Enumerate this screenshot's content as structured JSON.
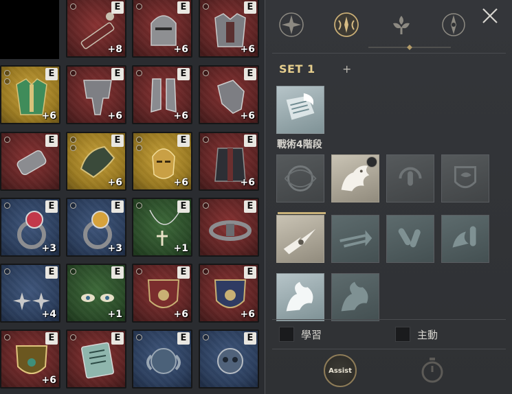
{
  "inventory": {
    "rows": [
      [
        null,
        {
          "icon": "blaster-cannon-icon",
          "badge": "E",
          "level": "+8",
          "color": "red"
        },
        {
          "icon": "knight-helmet-icon",
          "badge": "E",
          "level": "+6",
          "color": "red"
        },
        {
          "icon": "plate-armor-icon",
          "badge": "E",
          "level": "+6",
          "color": "red"
        }
      ],
      [
        {
          "icon": "green-tunic-icon",
          "badge": "E",
          "level": "+6",
          "color": "gold"
        },
        {
          "icon": "plate-greaves-icon",
          "badge": "E",
          "level": "+6",
          "color": "red"
        },
        {
          "icon": "armored-boots-icon",
          "badge": "E",
          "level": "+6",
          "color": "red"
        },
        {
          "icon": "gauntlet-icon",
          "badge": "E",
          "level": "+6",
          "color": "red"
        }
      ],
      [
        {
          "icon": "bracer-icon",
          "badge": "E",
          "level": "",
          "color": "red"
        },
        {
          "icon": "shoulder-pauldron-icon",
          "badge": "E",
          "level": "+6",
          "color": "gold"
        },
        {
          "icon": "golden-mask-icon",
          "badge": "E",
          "level": "+6",
          "color": "gold"
        },
        {
          "icon": "dark-cloak-icon",
          "badge": "E",
          "level": "+6",
          "color": "red"
        }
      ],
      [
        {
          "icon": "red-eye-ring-icon",
          "badge": "E",
          "level": "+3",
          "color": "blue"
        },
        {
          "icon": "amber-eye-ring-icon",
          "badge": "E",
          "level": "+3",
          "color": "blue"
        },
        {
          "icon": "cross-necklace-icon",
          "badge": "E",
          "level": "+1",
          "color": "green"
        },
        {
          "icon": "spiked-belt-icon",
          "badge": "E",
          "level": "",
          "color": "red"
        }
      ],
      [
        {
          "icon": "star-earrings-icon",
          "badge": "E",
          "level": "+4",
          "color": "blue"
        },
        {
          "icon": "eye-earrings-icon",
          "badge": "E",
          "level": "+1",
          "color": "green"
        },
        {
          "icon": "red-crest-shield-icon",
          "badge": "E",
          "level": "+6",
          "color": "red"
        },
        {
          "icon": "blue-crest-shield-icon",
          "badge": "E",
          "level": "+6",
          "color": "red"
        }
      ],
      [
        {
          "icon": "gold-crest-shield-icon",
          "badge": "E",
          "level": "+6",
          "color": "red"
        },
        {
          "icon": "rune-tablet-icon",
          "badge": "E",
          "level": "",
          "color": "red"
        },
        {
          "icon": "ram-skull-icon",
          "badge": "E",
          "level": "",
          "color": "blue"
        },
        {
          "icon": "demon-skull-icon",
          "badge": "E",
          "level": "",
          "color": "blue"
        }
      ]
    ]
  },
  "panel": {
    "tabs": [
      {
        "icon": "compass-star-icon"
      },
      {
        "icon": "winged-emblem-icon"
      },
      {
        "icon": "fleur-ornament-icon"
      },
      {
        "icon": "compass-needle-icon"
      }
    ],
    "set_title": "SET 1",
    "add_label": "+",
    "stage_label": "戰術4階段",
    "learn_label": "學習",
    "active_label": "主動",
    "assist_label": "Assist"
  }
}
